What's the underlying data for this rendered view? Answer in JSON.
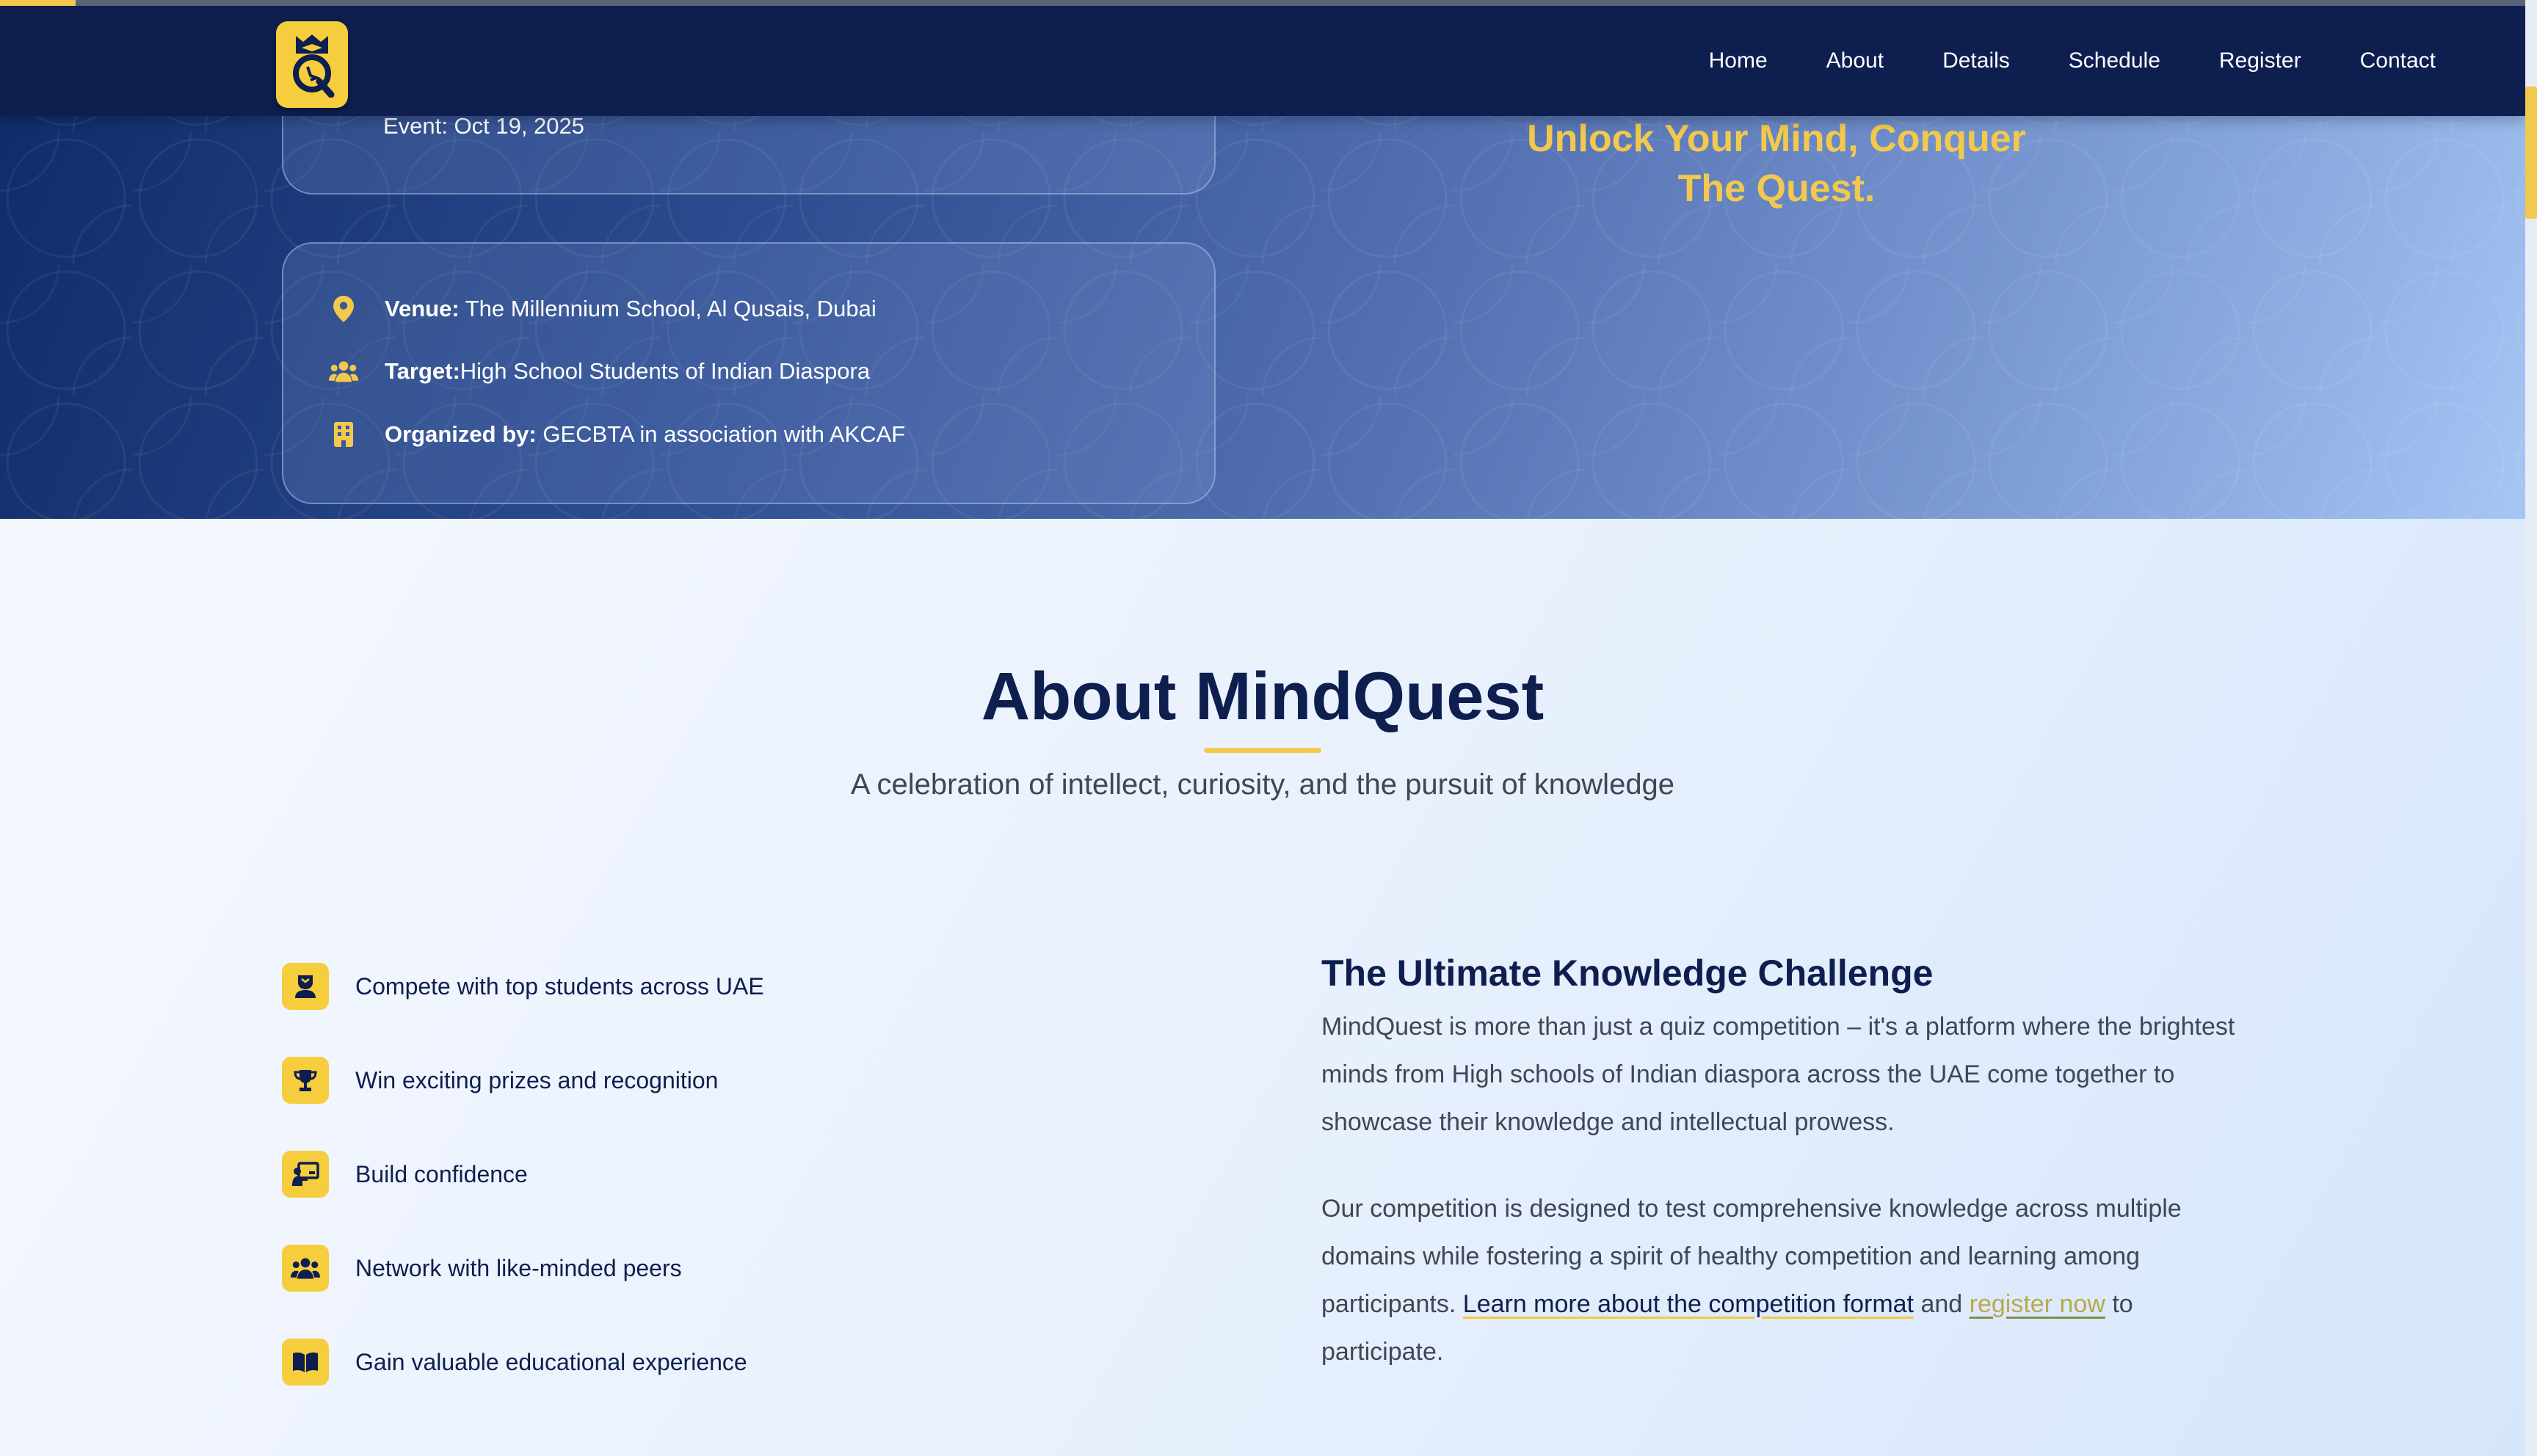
{
  "nav": {
    "links": [
      "Home",
      "About",
      "Details",
      "Schedule",
      "Register",
      "Contact"
    ]
  },
  "hero": {
    "event_date": "Event: Oct 19, 2025",
    "venue_label": "Venue:",
    "venue_value": "The Millennium School, Al Qusais, Dubai",
    "target_label": "Target:",
    "target_value": "High School Students of Indian Diaspora",
    "organizer_label": "Organized by:",
    "organizer_value": "GECBTA in association with AKCAF",
    "tagline_line1": "Unlock Your Mind, Conquer",
    "tagline_line2": "The Quest."
  },
  "about": {
    "title": "About MindQuest",
    "subtitle": "A celebration of intellect, curiosity, and the pursuit of knowledge",
    "features": [
      {
        "text": "Compete with top students across UAE",
        "icon": "student-icon"
      },
      {
        "text": "Win exciting prizes and recognition",
        "icon": "trophy-icon"
      },
      {
        "text": "Build confidence",
        "icon": "presentation-icon"
      },
      {
        "text": "Network with like-minded peers",
        "icon": "people-icon"
      },
      {
        "text": "Gain valuable educational experience",
        "icon": "book-icon"
      }
    ],
    "challenge_title": "The Ultimate Knowledge Challenge",
    "paragraph1": "MindQuest is more than just a quiz competition – it's a platform where the brightest minds from High schools of Indian diaspora across the UAE come together to showcase their knowledge and intellectual prowess.",
    "paragraph2_start": "Our competition is designed to test comprehensive knowledge across multiple domains while fostering a spirit of healthy competition and learning among participants.",
    "link_format": "Learn more about the competition format",
    "and_text": "and",
    "link_register": "register now",
    "paragraph2_end": "to participate."
  },
  "page_scroll_progress": 0.03,
  "colors": {
    "navy": "#0e1e4f",
    "gold": "#f2c94c",
    "logo_gold": "#f6cd3d",
    "body_text": "#3f4654",
    "link_gold": "#b9a948"
  }
}
